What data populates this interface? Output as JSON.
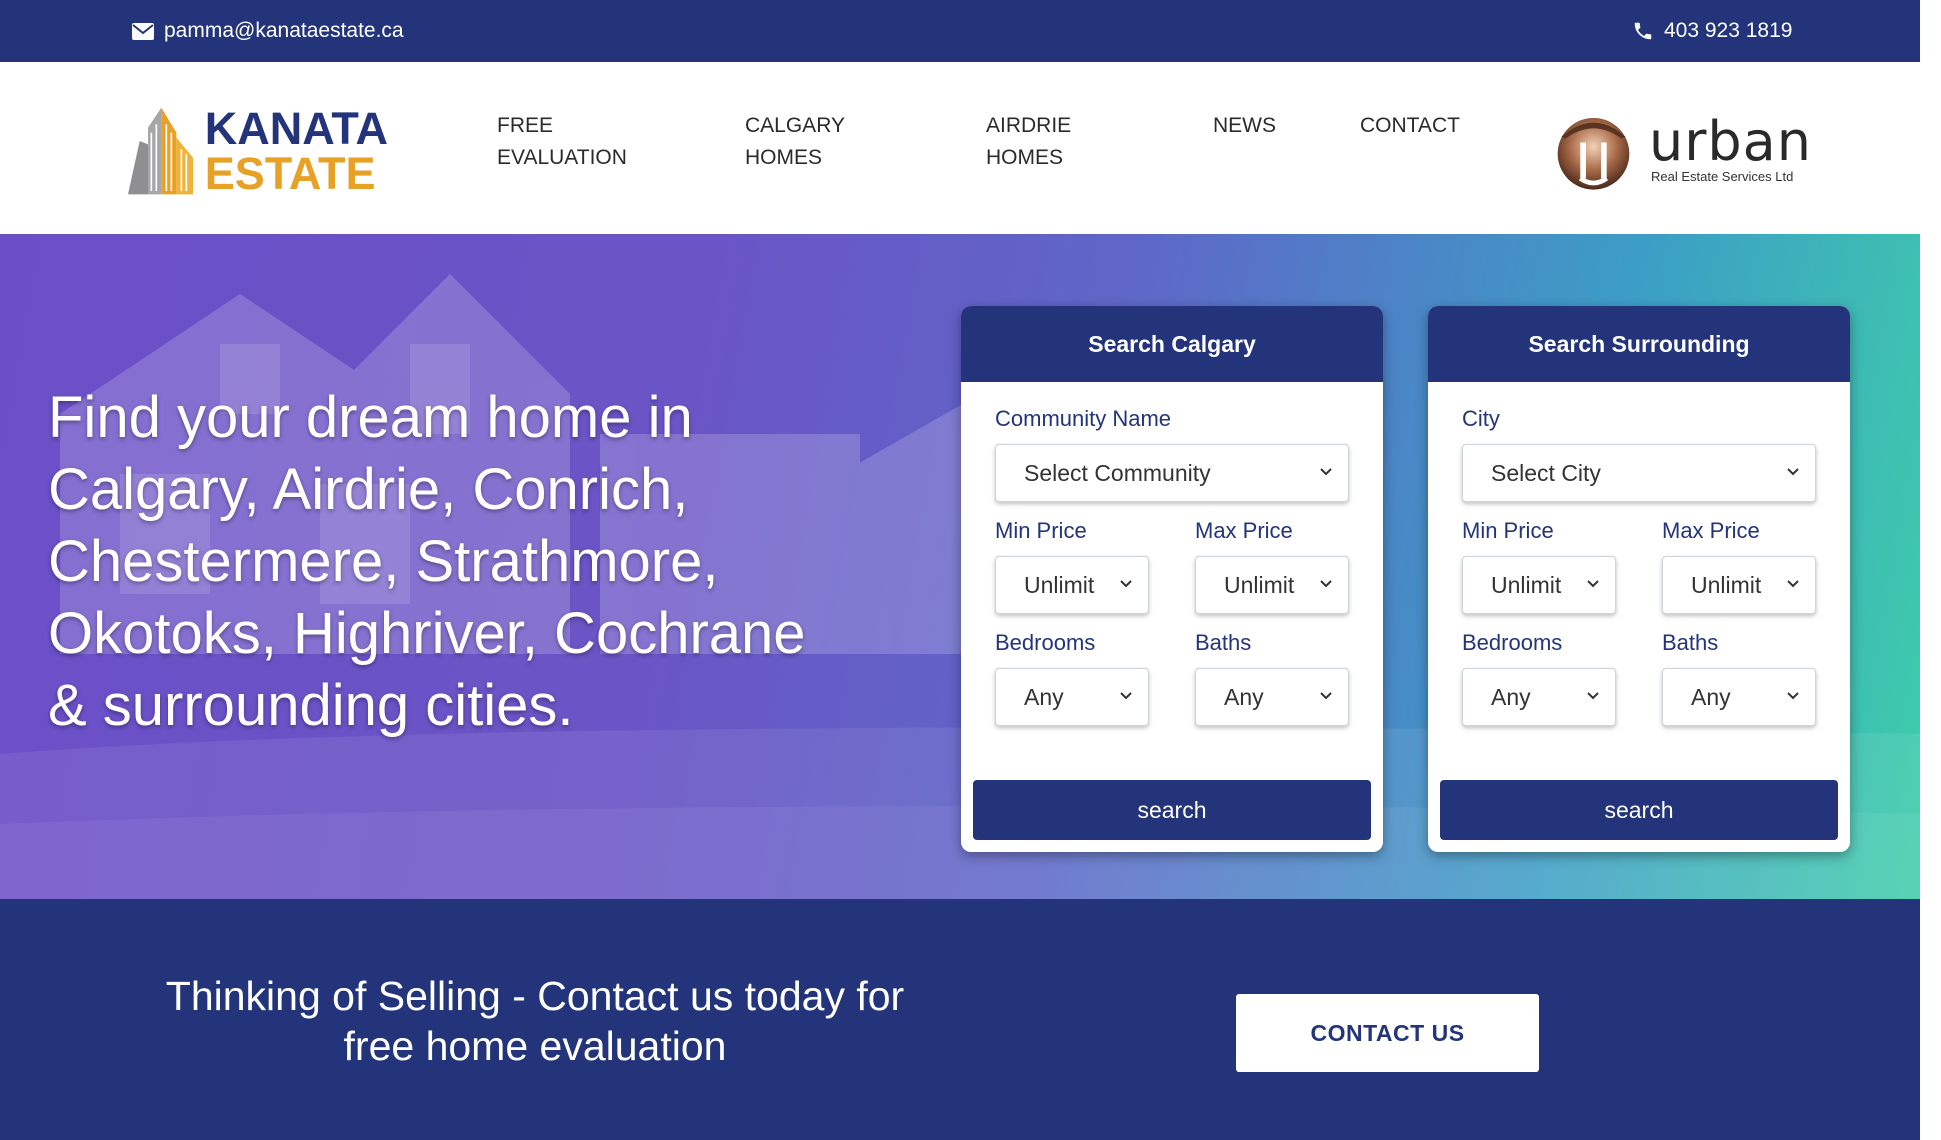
{
  "topbar": {
    "email": "pamma@kanataestate.ca",
    "phone": "403 923 1819",
    "email_icon": "envelope-icon",
    "phone_icon": "phone-icon"
  },
  "header": {
    "logo": {
      "line1": "KANATA",
      "line2": "ESTATE"
    },
    "nav": [
      {
        "line1": "FREE",
        "line2": "EVALUATION"
      },
      {
        "line1": "CALGARY",
        "line2": "HOMES"
      },
      {
        "line1": "AIRDRIE",
        "line2": "HOMES"
      },
      {
        "line1": "NEWS",
        "line2": ""
      },
      {
        "line1": "CONTACT",
        "line2": ""
      }
    ],
    "partner": {
      "name": "urban",
      "tagline": "Real Estate Services Ltd"
    }
  },
  "hero": {
    "title_lines": [
      "Find your dream home in",
      "Calgary, Airdrie, Conrich,",
      "Chestermere, Strathmore,",
      "Okotoks, Highriver, Cochrane",
      "& surrounding cities."
    ],
    "calgary": {
      "title": "Search Calgary",
      "field1_label": "Community Name",
      "field1_value": "Select Community",
      "min_label": "Min Price",
      "min_value": "Unlimit",
      "max_label": "Max Price",
      "max_value": "Unlimit",
      "beds_label": "Bedrooms",
      "beds_value": "Any",
      "baths_label": "Baths",
      "baths_value": "Any",
      "button": "search"
    },
    "surrounding": {
      "title": "Search Surrounding",
      "field1_label": "City",
      "field1_value": "Select City",
      "min_label": "Min Price",
      "min_value": "Unlimit",
      "max_label": "Max Price",
      "max_value": "Unlimit",
      "beds_label": "Bedrooms",
      "beds_value": "Any",
      "baths_label": "Baths",
      "baths_value": "Any",
      "button": "search"
    }
  },
  "sell": {
    "line1": "Thinking of Selling - Contact us today for",
    "line2": "free home evaluation",
    "button": "CONTACT US"
  },
  "colors": {
    "navy": "#23347a",
    "gold": "#e7a126",
    "hero_start": "#6b4fc7",
    "hero_end": "#3fd0a8"
  }
}
